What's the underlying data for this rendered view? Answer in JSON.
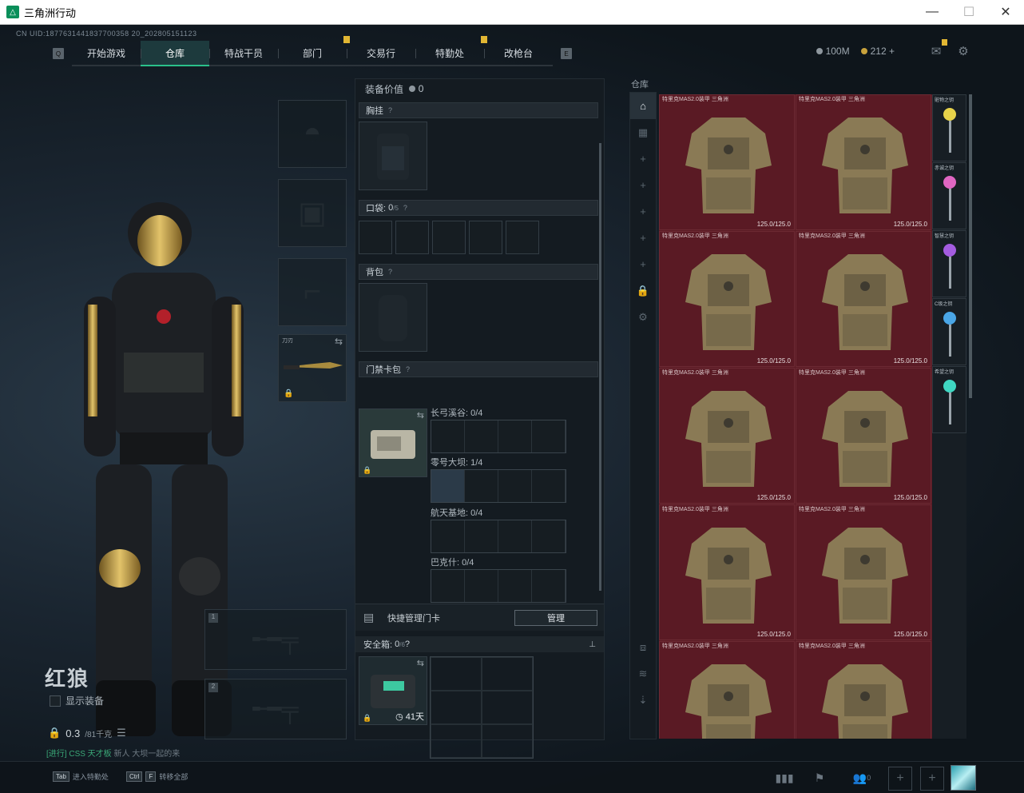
{
  "window": {
    "title": "三角洲行动",
    "minimize": "—",
    "maximize": "☐",
    "close": "✕"
  },
  "uid": "CN UID:1877631441837700358 20_202805151123",
  "nav": {
    "tabs": [
      {
        "label": "开始游戏",
        "badge": false
      },
      {
        "label": "仓库",
        "badge": false,
        "active": true
      },
      {
        "label": "特战干员",
        "badge": false
      },
      {
        "label": "部门",
        "badge": true
      },
      {
        "label": "交易行",
        "badge": false
      },
      {
        "label": "特勤处",
        "badge": true
      },
      {
        "label": "改枪台",
        "badge": false
      }
    ]
  },
  "currency": {
    "coins": "100M",
    "tickets": "212",
    "add": "+"
  },
  "character": {
    "name": "红狼",
    "show_equipment": "显示装备",
    "weight": "0.3",
    "weight_max": "/81千克",
    "tip_prefix": "[进行]",
    "tip_green": "CSS 天才板",
    "tip_rest": "新人 大坝一起的来"
  },
  "weapon_slot": {
    "label": "刀刃"
  },
  "middle": {
    "value_label": "装备价值",
    "value": "0",
    "chest_rig": "胸挂",
    "pocket": "口袋:",
    "pocket_count": "0",
    "pocket_max": "/5",
    "backpack": "背包",
    "keycard_bag": "门禁卡包",
    "card_rows": [
      {
        "label": "长弓溪谷: 0/4"
      },
      {
        "label": "零号大坝: 1/4"
      },
      {
        "label": "航天基地: 0/4"
      },
      {
        "label": "巴克什: 0/4"
      }
    ],
    "quick_manage": "快捷管理门卡",
    "manage_btn": "管理",
    "safe_box": "安全箱:",
    "safe_count": "0",
    "safe_max": "/6",
    "safe_days": "41天"
  },
  "warehouse": {
    "title": "仓库",
    "vest_name": "特里克MAS2.0装甲 三角洲",
    "durability": "125.0/125.0",
    "keys": [
      {
        "name": "赃物之钥",
        "color": "#e7d34a"
      },
      {
        "name": "赤诚之钥",
        "color": "#e066c2"
      },
      {
        "name": "智慧之钥",
        "color": "#a45ce0"
      },
      {
        "name": "C级之钥",
        "color": "#4aa6e6"
      },
      {
        "name": "希望之钥",
        "color": "#3fd7c2"
      }
    ]
  },
  "bottom": {
    "tab_hint_key": "Tab",
    "tab_hint": "进入特勤处",
    "ctrl_key": "Ctrl",
    "f_key": "F",
    "ctrl_hint": "转移全部",
    "friends": "0"
  }
}
